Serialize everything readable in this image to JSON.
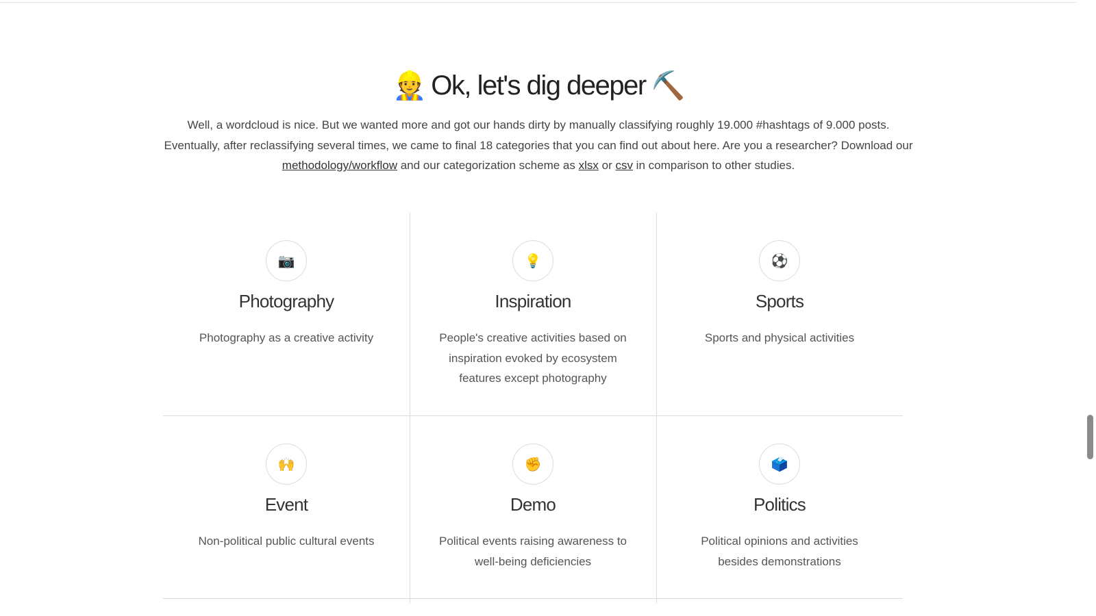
{
  "section": {
    "heading_prefix_emoji": "👷",
    "heading": "Ok, let's dig deeper",
    "heading_suffix_emoji": "⛏️",
    "intro_part1": "Well, a wordcloud is nice. But we wanted more and got our hands dirty by manually classifying roughly 19.000 #hashtags of 9.000 posts. Eventually, after reclassifying several times, we came to final 18 categories that you can find out about here. Are you a researcher? Download our ",
    "link_methodology": "methodology/workflow",
    "intro_part2": " and our categorization scheme as ",
    "link_xlsx": "xlsx",
    "intro_part3": " or ",
    "link_csv": "csv",
    "intro_part4": " in comparison to other studies."
  },
  "categories": [
    {
      "icon": "📷",
      "icon_name": "camera-icon",
      "title": "Photography",
      "description": "Photography as a creative activity"
    },
    {
      "icon": "💡",
      "icon_name": "lightbulb-icon",
      "title": "Inspiration",
      "description": "People's creative activities based on inspiration evoked by ecosystem features except photography"
    },
    {
      "icon": "⚽",
      "icon_name": "soccer-ball-icon",
      "title": "Sports",
      "description": "Sports and physical activities"
    },
    {
      "icon": "🙌",
      "icon_name": "raised-hands-icon",
      "title": "Event",
      "description": "Non-political public cultural events"
    },
    {
      "icon": "✊",
      "icon_name": "raised-fist-icon",
      "title": "Demo",
      "description": "Political events raising awareness to well-being deficiencies"
    },
    {
      "icon": "🗳️",
      "icon_name": "ballot-box-icon",
      "title": "Politics",
      "description": "Political opinions and activities besides demonstrations"
    }
  ],
  "colors": {
    "divider": "#dcdcdc",
    "text": "#333333",
    "scrollbar_thumb": "#8a8a8a"
  }
}
